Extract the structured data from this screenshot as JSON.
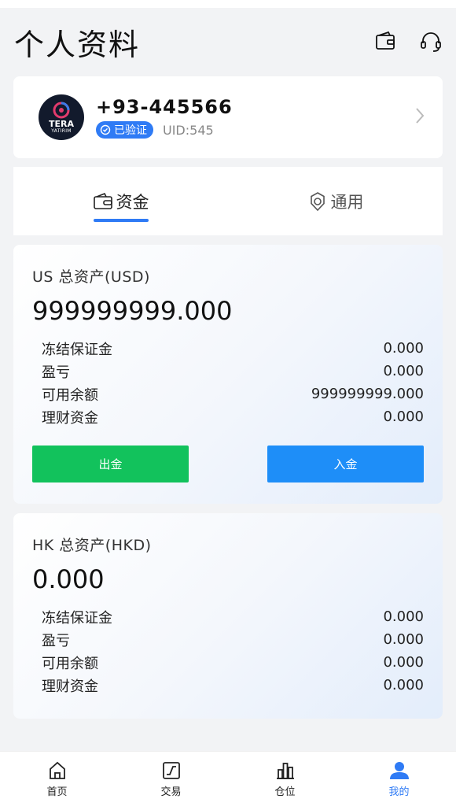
{
  "header": {
    "title": "个人资料",
    "icons": [
      "wallet-icon",
      "headset-icon"
    ]
  },
  "profile": {
    "phone": "+93-445566",
    "verified_label": "已验证",
    "uid": "UID:545",
    "avatar_brand": "TERA",
    "avatar_brand_sub": "YATIRIM"
  },
  "tabs": [
    {
      "label": "资金",
      "active": true,
      "icon": "wallet-tab-icon"
    },
    {
      "label": "通用",
      "active": false,
      "icon": "settings-icon"
    }
  ],
  "accounts": [
    {
      "title": "US 总资产(USD)",
      "total": "999999999.000",
      "rows": [
        {
          "label": "冻结保证金",
          "value": "0.000"
        },
        {
          "label": "盈亏",
          "value": "0.000"
        },
        {
          "label": "可用余额",
          "value": "999999999.000"
        },
        {
          "label": "理财资金",
          "value": "0.000"
        }
      ],
      "withdraw_label": "出金",
      "deposit_label": "入金"
    },
    {
      "title": "HK 总资产(HKD)",
      "total": "0.000",
      "rows": [
        {
          "label": "冻结保证金",
          "value": "0.000"
        },
        {
          "label": "盈亏",
          "value": "0.000"
        },
        {
          "label": "可用余额",
          "value": "0.000"
        },
        {
          "label": "理财资金",
          "value": "0.000"
        }
      ]
    }
  ],
  "nav": [
    {
      "label": "首页",
      "icon": "home-icon",
      "active": false
    },
    {
      "label": "交易",
      "icon": "trade-icon",
      "active": false
    },
    {
      "label": "仓位",
      "icon": "position-icon",
      "active": false
    },
    {
      "label": "我的",
      "icon": "user-icon",
      "active": true
    }
  ],
  "colors": {
    "accent": "#2f7bf5",
    "withdraw": "#12c25c",
    "deposit": "#1e8ef8"
  }
}
